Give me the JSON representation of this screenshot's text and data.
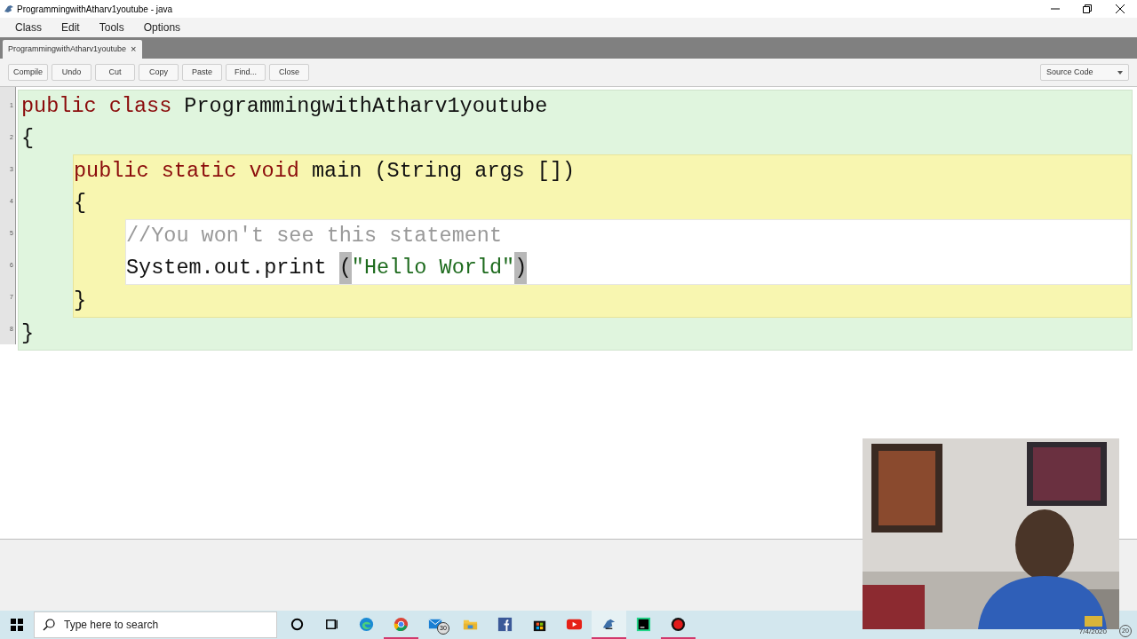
{
  "window": {
    "title": "ProgrammingwithAtharv1youtube - java"
  },
  "menu": [
    "Class",
    "Edit",
    "Tools",
    "Options"
  ],
  "tabs": [
    {
      "label": "ProgrammingwithAtharv1youtube",
      "close": "×",
      "selected": true
    }
  ],
  "toolbar": {
    "buttons": [
      "Compile",
      "Undo",
      "Cut",
      "Copy",
      "Paste",
      "Find...",
      "Close"
    ],
    "view_select": {
      "value": "Source Code"
    }
  },
  "code": {
    "head": [
      {
        "number": "1",
        "tokens": [
          {
            "text": "public ",
            "kind": "keyword"
          },
          {
            "text": "class ",
            "kind": "keyword"
          },
          {
            "text": "ProgrammingwithAtharv1youtube",
            "kind": "plain"
          }
        ]
      },
      {
        "number": "2",
        "tokens": [
          {
            "text": "{",
            "kind": "plain"
          }
        ]
      }
    ],
    "block": {
      "head": [
        {
          "number": "3",
          "tokens": [
            {
              "text": "public ",
              "kind": "keyword"
            },
            {
              "text": "static ",
              "kind": "keyword"
            },
            {
              "text": "void ",
              "kind": "keyword"
            },
            {
              "text": "main (String args [])",
              "kind": "plain"
            }
          ]
        },
        {
          "number": "4",
          "tokens": [
            {
              "text": "{",
              "kind": "plain"
            }
          ]
        }
      ],
      "block": {
        "head": [
          {
            "number": "5",
            "tokens": [
              {
                "text": "//You won't see this statement",
                "kind": "comment"
              }
            ]
          },
          {
            "number": "6",
            "tokens": [
              {
                "text": "System.out.print ",
                "kind": "plain"
              },
              {
                "text": "(",
                "kind": "bracket"
              },
              {
                "text": "\"Hello World\"",
                "kind": "string"
              },
              {
                "text": ")",
                "kind": "bracket"
              }
            ]
          }
        ]
      },
      "tail": [
        {
          "number": "7",
          "tokens": [
            {
              "text": "}",
              "kind": "plain"
            }
          ]
        }
      ]
    },
    "tail": [
      {
        "number": "8",
        "tokens": [
          {
            "text": "}",
            "kind": "plain"
          }
        ]
      }
    ]
  },
  "taskbar": {
    "search": {
      "placeholder": "Type here to search"
    },
    "apps": [
      {
        "kind": "cortana",
        "active": false
      },
      {
        "kind": "taskview",
        "active": false
      },
      {
        "kind": "edge",
        "active": false
      },
      {
        "kind": "chrome",
        "active": true
      },
      {
        "kind": "mail",
        "active": false,
        "badge": "30"
      },
      {
        "kind": "files",
        "active": false
      },
      {
        "kind": "facebook",
        "active": false
      },
      {
        "kind": "store",
        "active": false
      },
      {
        "kind": "youtube",
        "active": false
      },
      {
        "kind": "bird",
        "active": true
      },
      {
        "kind": "pycharm",
        "active": false
      },
      {
        "kind": "record",
        "active": true
      }
    ],
    "date": "7/4/2020",
    "notifications": "20"
  }
}
